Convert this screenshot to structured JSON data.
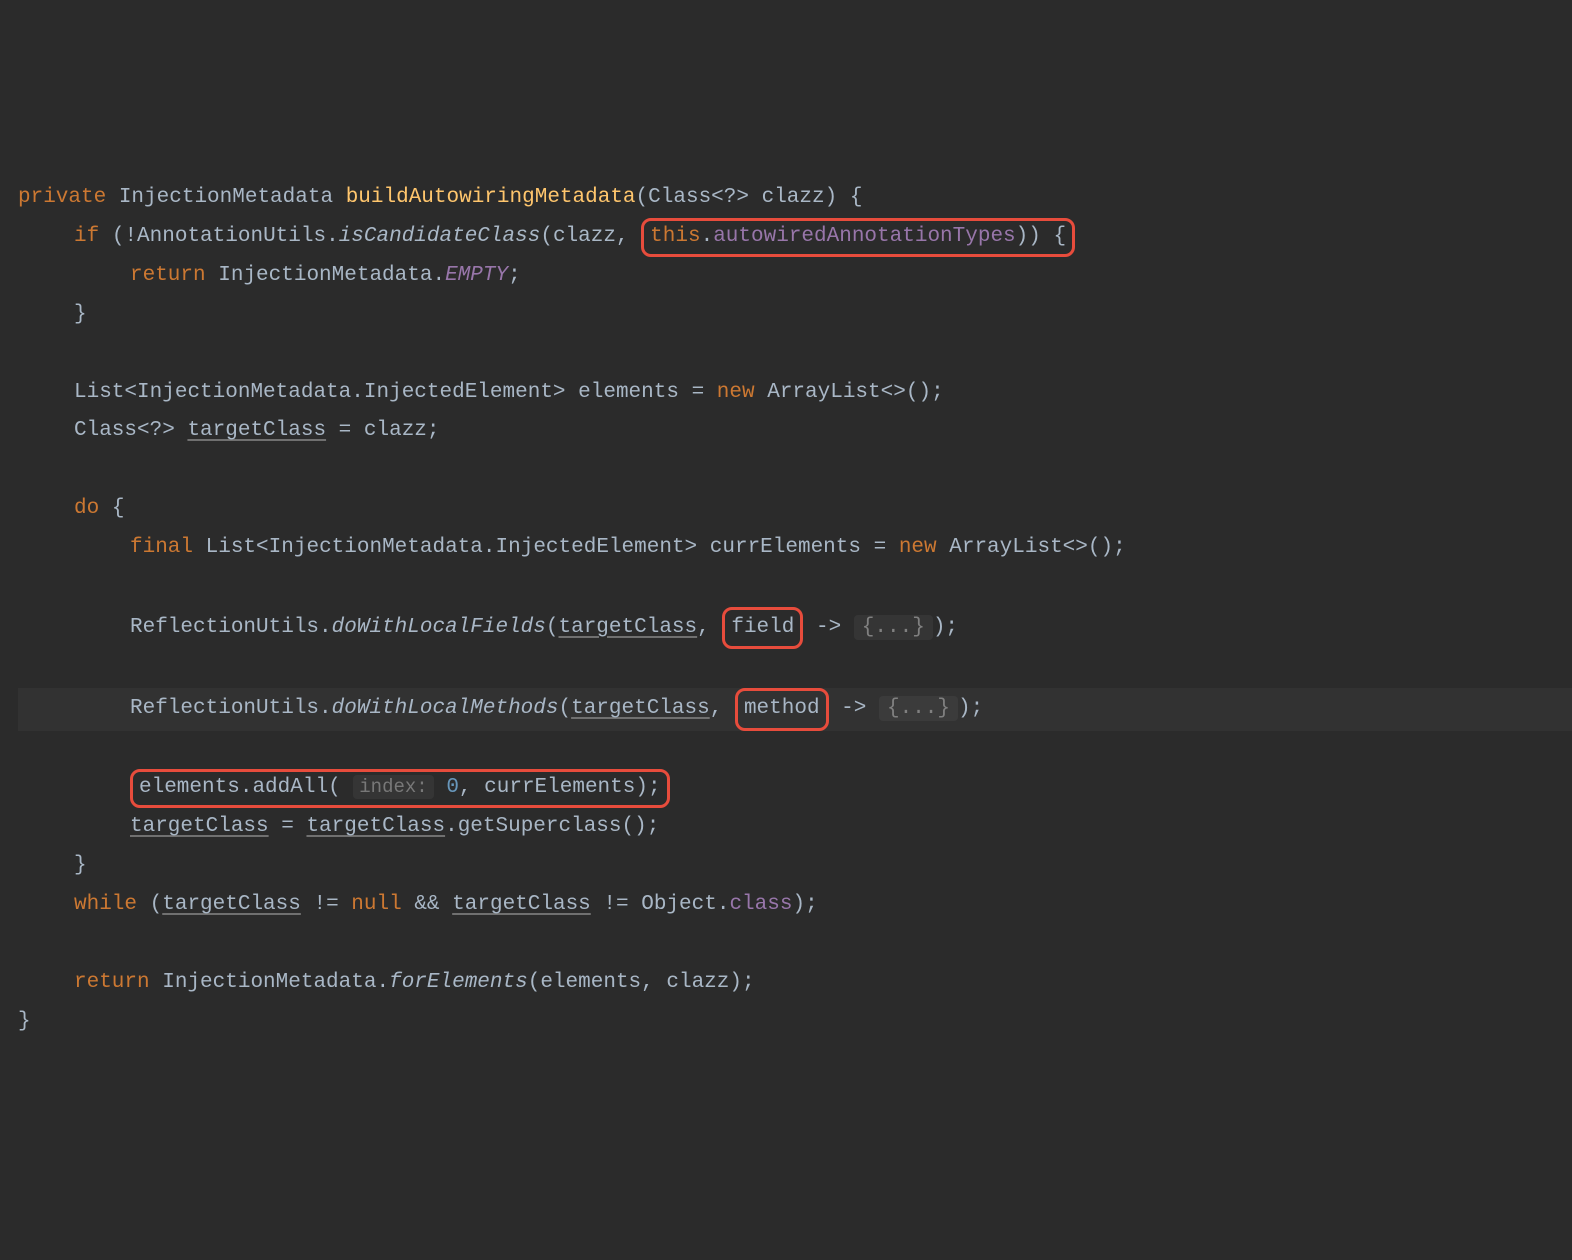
{
  "kw": {
    "private": "private",
    "if": "if",
    "return": "return",
    "do": "do",
    "final": "final",
    "new": "new",
    "this": "this",
    "while": "while",
    "null": "null"
  },
  "types": {
    "InjectionMetadata": "InjectionMetadata",
    "Class": "Class",
    "List": "List",
    "InjectedElement": "InjectedElement",
    "ArrayList": "ArrayList",
    "Object": "Object"
  },
  "methodDecl": "buildAutowiringMetadata",
  "calls": {
    "AnnotationUtils": "AnnotationUtils",
    "isCandidateClass": "isCandidateClass",
    "ReflectionUtils": "ReflectionUtils",
    "doWithLocalFields": "doWithLocalFields",
    "doWithLocalMethods": "doWithLocalMethods",
    "addAll": "addAll",
    "getSuperclass": "getSuperclass",
    "forElements": "forElements"
  },
  "idents": {
    "clazz": "clazz",
    "autowiredAnnotationTypes": "autowiredAnnotationTypes",
    "EMPTY": "EMPTY",
    "elements": "elements",
    "targetClass": "targetClass",
    "currElements": "currElements",
    "field": "field",
    "method": "method",
    "classField": "class"
  },
  "hints": {
    "indexLabel": "index:",
    "indexValue": "0"
  },
  "fold": "{...}",
  "punct": {
    "wildcard": "<?>",
    "diamond": "<>",
    "lparen": "(",
    "rparen": ")",
    "lbrace": "{",
    "rbrace": "}",
    "lt": "<",
    "gt": ">",
    "dot": ".",
    "comma": ",",
    "semicolon": ";",
    "bang": "!",
    "assign": "=",
    "arrow": "->",
    "neq": "!=",
    "andand": "&&"
  }
}
